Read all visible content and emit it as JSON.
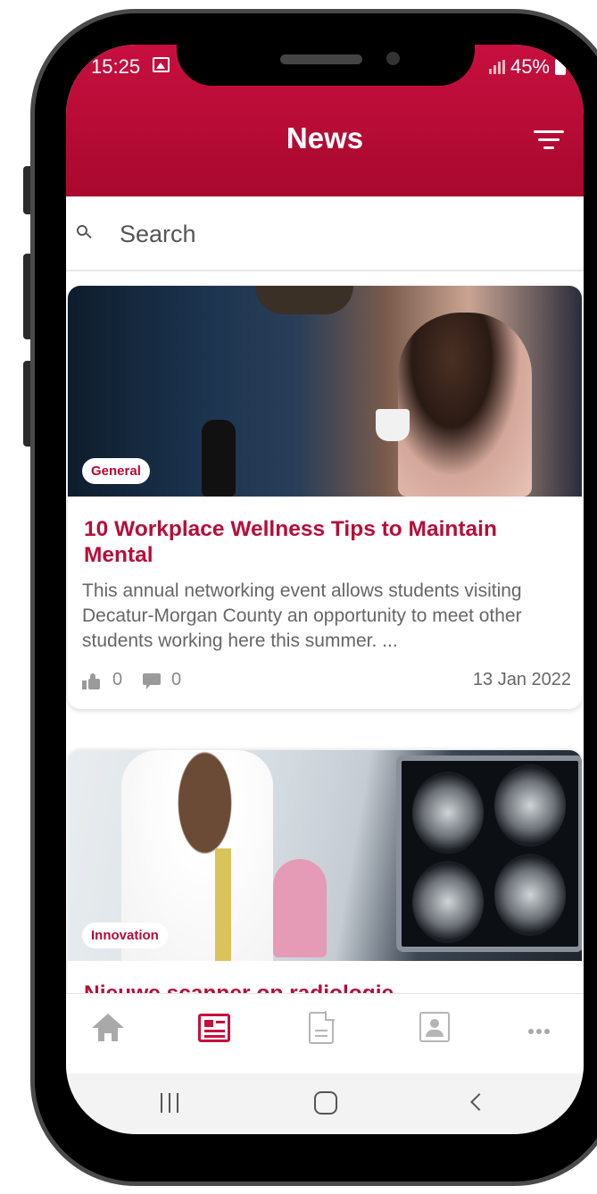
{
  "status_bar": {
    "time": "15:25",
    "battery": "45%"
  },
  "header": {
    "title": "News"
  },
  "search": {
    "placeholder": "Search"
  },
  "articles": [
    {
      "category": "General",
      "title": "10 Workplace Wellness Tips to Maintain Mental",
      "description": "This annual networking event allows students visiting Decatur-Morgan County an opportunity to meet other students working here this summer. ...",
      "likes": "0",
      "comments": "0",
      "date": "13 Jan 2022"
    },
    {
      "category": "Innovation",
      "title": "Nieuwe scanner op radiologie"
    }
  ],
  "bottom_nav": {
    "active_tab": "news",
    "tabs": [
      "home",
      "news",
      "documents",
      "contacts",
      "more"
    ],
    "icons": [
      "home-icon",
      "news-icon",
      "document-icon",
      "contact-icon",
      "more-icon"
    ]
  },
  "colors": {
    "accent": "#c70f3f",
    "inactive_icon": "#b5b5b5",
    "meta_text": "#888888"
  }
}
